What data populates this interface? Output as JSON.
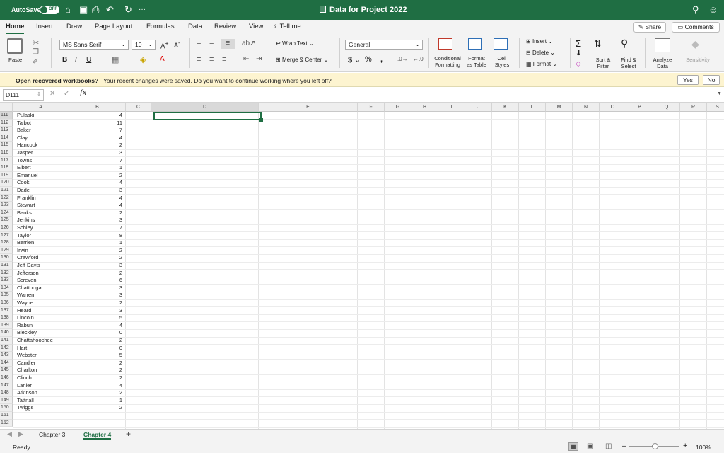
{
  "titlebar": {
    "autosave_label": "AutoSave",
    "toggle_state": "OFF",
    "title": "Data for Project 2022",
    "more": "···"
  },
  "tabs": [
    "Home",
    "Insert",
    "Draw",
    "Page Layout",
    "Formulas",
    "Data",
    "Review",
    "View",
    "Tell me"
  ],
  "share_label": "Share",
  "comments_label": "Comments",
  "ribbon": {
    "paste_label": "Paste",
    "font_name": "MS Sans Serif",
    "font_size": "10",
    "wrap_text": "Wrap Text",
    "merge_center": "Merge & Center",
    "number_format": "General",
    "conditional_formatting": [
      "Conditional",
      "Formatting"
    ],
    "format_as_table": [
      "Format",
      "as Table"
    ],
    "cell_styles": [
      "Cell",
      "Styles"
    ],
    "insert": "Insert",
    "delete": "Delete",
    "format": "Format",
    "sort_filter": [
      "Sort &",
      "Filter"
    ],
    "find_select": [
      "Find &",
      "Select"
    ],
    "analyze_data": [
      "Analyze",
      "Data"
    ],
    "sensitivity": "Sensitivity"
  },
  "notification": {
    "title": "Open recovered workbooks?",
    "message": "Your recent changes were saved. Do you want to continue working where you left off?",
    "yes": "Yes",
    "no": "No"
  },
  "formula_bar": {
    "name_box": "D111",
    "fx": "fx",
    "value": ""
  },
  "columns": [
    "A",
    "B",
    "C",
    "D",
    "E",
    "F",
    "G",
    "H",
    "I",
    "J",
    "K",
    "L",
    "M",
    "N",
    "O",
    "P",
    "Q",
    "R",
    "S"
  ],
  "rows": [
    {
      "num": "111",
      "a": "Pulaski",
      "b": "4"
    },
    {
      "num": "112",
      "a": "Talbot",
      "b": "11"
    },
    {
      "num": "113",
      "a": "Baker",
      "b": "7"
    },
    {
      "num": "114",
      "a": "Clay",
      "b": "4"
    },
    {
      "num": "115",
      "a": "Hancock",
      "b": "2"
    },
    {
      "num": "116",
      "a": "Jasper",
      "b": "3"
    },
    {
      "num": "117",
      "a": "Towns",
      "b": "7"
    },
    {
      "num": "118",
      "a": "Elbert",
      "b": "1"
    },
    {
      "num": "119",
      "a": "Emanuel",
      "b": "2"
    },
    {
      "num": "120",
      "a": "Cook",
      "b": "4"
    },
    {
      "num": "121",
      "a": "Dade",
      "b": "3"
    },
    {
      "num": "122",
      "a": "Franklin",
      "b": "4"
    },
    {
      "num": "123",
      "a": "Stewart",
      "b": "4"
    },
    {
      "num": "124",
      "a": "Banks",
      "b": "2"
    },
    {
      "num": "125",
      "a": "Jenkins",
      "b": "3"
    },
    {
      "num": "126",
      "a": "Schley",
      "b": "7"
    },
    {
      "num": "127",
      "a": "Taylor",
      "b": "8"
    },
    {
      "num": "128",
      "a": "Berrien",
      "b": "1"
    },
    {
      "num": "129",
      "a": "Irwin",
      "b": "2"
    },
    {
      "num": "130",
      "a": "Crawford",
      "b": "2"
    },
    {
      "num": "131",
      "a": "Jeff Davis",
      "b": "3"
    },
    {
      "num": "132",
      "a": "Jefferson",
      "b": "2"
    },
    {
      "num": "133",
      "a": "Screven",
      "b": "6"
    },
    {
      "num": "134",
      "a": "Chattooga",
      "b": "3"
    },
    {
      "num": "135",
      "a": "Warren",
      "b": "3"
    },
    {
      "num": "136",
      "a": "Wayne",
      "b": "2"
    },
    {
      "num": "137",
      "a": "Heard",
      "b": "3"
    },
    {
      "num": "138",
      "a": "Lincoln",
      "b": "5"
    },
    {
      "num": "139",
      "a": "Rabun",
      "b": "4"
    },
    {
      "num": "140",
      "a": "Bleckley",
      "b": "0"
    },
    {
      "num": "141",
      "a": "Chattahoochee",
      "b": "2"
    },
    {
      "num": "142",
      "a": "Hart",
      "b": "0"
    },
    {
      "num": "143",
      "a": "Webster",
      "b": "5"
    },
    {
      "num": "144",
      "a": "Candler",
      "b": "2"
    },
    {
      "num": "145",
      "a": "Charlton",
      "b": "2"
    },
    {
      "num": "146",
      "a": "Clinch",
      "b": "2"
    },
    {
      "num": "147",
      "a": "Lanier",
      "b": "4"
    },
    {
      "num": "148",
      "a": "Atkinson",
      "b": "2"
    },
    {
      "num": "149",
      "a": "Tattnall",
      "b": "1"
    },
    {
      "num": "150",
      "a": "Twiggs",
      "b": "2"
    },
    {
      "num": "151",
      "a": "",
      "b": ""
    },
    {
      "num": "152",
      "a": "",
      "b": ""
    }
  ],
  "sheets": [
    {
      "name": "Chapter 3",
      "active": false
    },
    {
      "name": "Chapter 4",
      "active": true
    }
  ],
  "status": {
    "ready": "Ready",
    "zoom": "100%"
  },
  "colors": {
    "brand": "#1f6e43",
    "notify_bg": "#fdf4d0"
  }
}
